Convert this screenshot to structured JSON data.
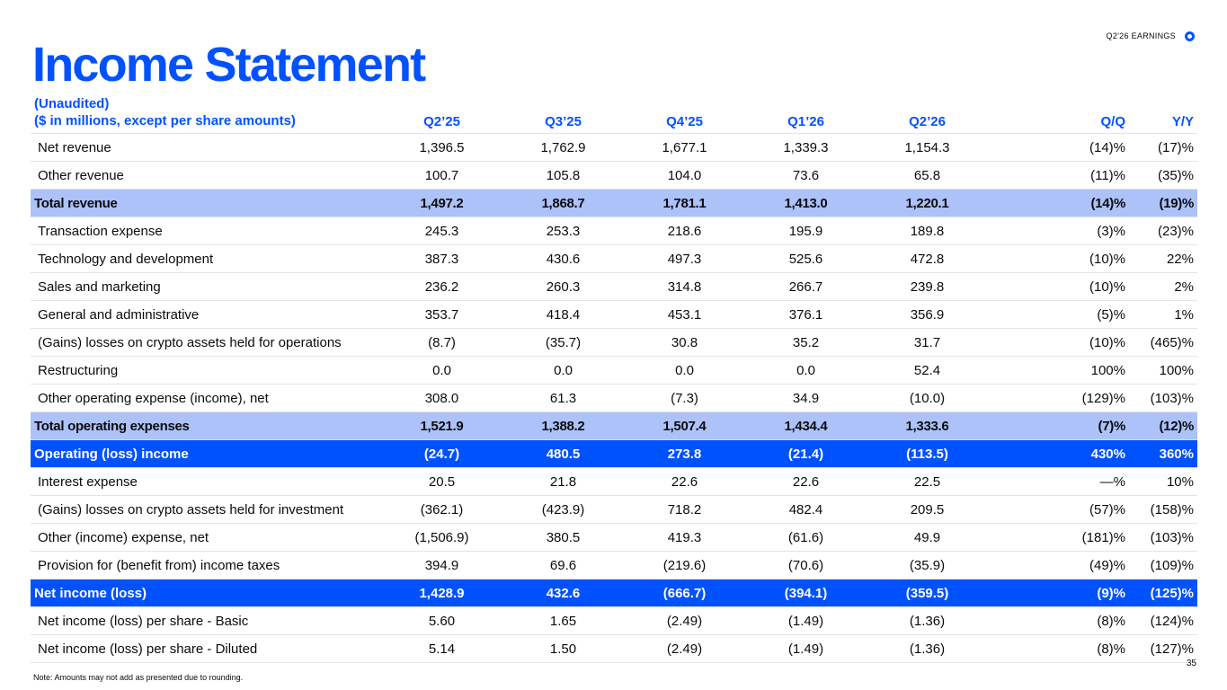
{
  "page": {
    "title": "Income Statement",
    "brand_label": "Q2'26 EARNINGS",
    "footnote": "Note: Amounts may not add as presented due to rounding.",
    "page_number": "35"
  },
  "colors": {
    "accent_blue": "#0052ff",
    "total_row_bg": "#adc2f9",
    "highlight_row_bg": "#0052ff",
    "text": "#0a0b0d",
    "divider": "#e2e4e8"
  },
  "icons": {
    "logo": "coinbase-logo-icon"
  },
  "table": {
    "header": {
      "label_line1": "(Unaudited)",
      "label_line2": "($ in millions, except per share amounts)",
      "columns": [
        "Q2’25",
        "Q3’25",
        "Q4’25",
        "Q1’26",
        "Q2’26",
        "Q/Q",
        "Y/Y"
      ]
    },
    "rows": [
      {
        "style": "normal",
        "label": "Net revenue",
        "values": [
          "1,396.5",
          "1,762.9",
          "1,677.1",
          "1,339.3",
          "1,154.3",
          "(14)%",
          "(17)%"
        ]
      },
      {
        "style": "normal",
        "label": "Other revenue",
        "values": [
          "100.7",
          "105.8",
          "104.0",
          "73.6",
          "65.8",
          "(11)%",
          "(35)%"
        ]
      },
      {
        "style": "total",
        "label": "Total revenue",
        "values": [
          "1,497.2",
          "1,868.7",
          "1,781.1",
          "1,413.0",
          "1,220.1",
          "(14)%",
          "(19)%"
        ]
      },
      {
        "style": "normal",
        "label": "Transaction expense",
        "values": [
          "245.3",
          "253.3",
          "218.6",
          "195.9",
          "189.8",
          "(3)%",
          "(23)%"
        ]
      },
      {
        "style": "normal",
        "label": "Technology and development",
        "values": [
          "387.3",
          "430.6",
          "497.3",
          "525.6",
          "472.8",
          "(10)%",
          "22%"
        ]
      },
      {
        "style": "normal",
        "label": "Sales and marketing",
        "values": [
          "236.2",
          "260.3",
          "314.8",
          "266.7",
          "239.8",
          "(10)%",
          "2%"
        ]
      },
      {
        "style": "normal",
        "label": "General and administrative",
        "values": [
          "353.7",
          "418.4",
          "453.1",
          "376.1",
          "356.9",
          "(5)%",
          "1%"
        ]
      },
      {
        "style": "normal",
        "label": "(Gains) losses on crypto assets held for operations",
        "values": [
          "(8.7)",
          "(35.7)",
          "30.8",
          "35.2",
          "31.7",
          "(10)%",
          "(465)%"
        ]
      },
      {
        "style": "normal",
        "label": " Restructuring",
        "values": [
          "0.0",
          "0.0",
          "0.0",
          "0.0",
          "52.4",
          "100%",
          "100%"
        ]
      },
      {
        "style": "normal",
        "label": "Other operating expense (income), net",
        "values": [
          "308.0",
          "61.3",
          "(7.3)",
          "34.9",
          "(10.0)",
          "(129)%",
          "(103)%"
        ]
      },
      {
        "style": "total",
        "label": "Total operating expenses",
        "values": [
          "1,521.9",
          "1,388.2",
          "1,507.4",
          "1,434.4",
          "1,333.6",
          "(7)%",
          "(12)%"
        ]
      },
      {
        "style": "highlight",
        "label": "Operating (loss) income",
        "values": [
          "(24.7)",
          "480.5",
          "273.8",
          "(21.4)",
          "(113.5)",
          "430%",
          "360%"
        ]
      },
      {
        "style": "normal",
        "label": "Interest expense",
        "values": [
          "20.5",
          "21.8",
          "22.6",
          "22.6",
          "22.5",
          "—%",
          "10%"
        ]
      },
      {
        "style": "normal",
        "label": "(Gains) losses on crypto assets held for investment",
        "values": [
          "(362.1)",
          "(423.9)",
          "718.2",
          "482.4",
          "209.5",
          "(57)%",
          "(158)%"
        ]
      },
      {
        "style": "normal",
        "label": "Other (income) expense, net",
        "values": [
          "(1,506.9)",
          "380.5",
          "419.3",
          "(61.6)",
          "49.9",
          "(181)%",
          "(103)%"
        ]
      },
      {
        "style": "normal",
        "label": "Provision for (benefit from) income taxes",
        "values": [
          "394.9",
          "69.6",
          "(219.6)",
          "(70.6)",
          "(35.9)",
          "(49)%",
          "(109)%"
        ]
      },
      {
        "style": "highlight",
        "label": "Net income (loss)",
        "values": [
          "1,428.9",
          "432.6",
          "(666.7)",
          "(394.1)",
          "(359.5)",
          "(9)%",
          "(125)%"
        ]
      },
      {
        "style": "normal",
        "label": "Net income (loss) per share - Basic",
        "values": [
          "5.60",
          "1.65",
          "(2.49)",
          "(1.49)",
          "(1.36)",
          "(8)%",
          "(124)%"
        ]
      },
      {
        "style": "normal",
        "label": "Net income (loss) per share - Diluted",
        "values": [
          "5.14",
          "1.50",
          "(2.49)",
          "(1.49)",
          "(1.36)",
          "(8)%",
          "(127)%"
        ]
      }
    ]
  }
}
